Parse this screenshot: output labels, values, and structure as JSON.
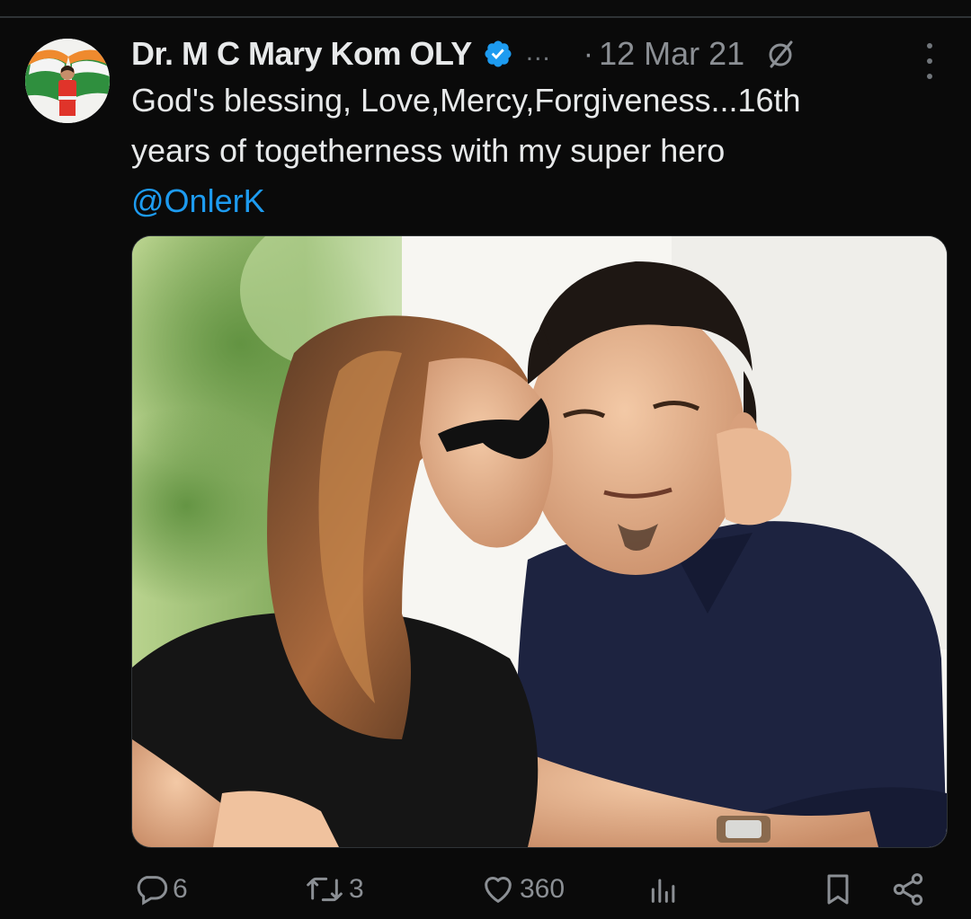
{
  "tweet": {
    "author": {
      "display_name": "Dr. M C Mary Kom OLY",
      "verified": true,
      "truncation": "...",
      "avatar_icon": "profile-avatar-icon"
    },
    "separator": "·",
    "timestamp": "12 Mar 21",
    "text_lines": [
      "God's blessing, Love,Mercy,Forgiveness...16th",
      "years of togetherness with my super hero"
    ],
    "mention": "@OnlerK",
    "media": {
      "type": "photo"
    },
    "actions": {
      "replies": "6",
      "reposts": "3",
      "likes": "360"
    },
    "icons": {
      "verified": "verified-badge-icon",
      "timestamp_slash": "no-edit-slash-icon",
      "more": "more-options-icon",
      "reply": "reply-bubble-icon",
      "repost": "repost-arrows-icon",
      "like": "heart-icon",
      "views": "views-bar-chart-icon",
      "bookmark": "bookmark-icon",
      "share": "share-icon"
    }
  },
  "colors": {
    "background": "#0a0a0a",
    "text_primary": "#e7e9ea",
    "text_secondary": "#8b8f94",
    "mention": "#1d9bf0",
    "verified": "#1d9bf0"
  }
}
